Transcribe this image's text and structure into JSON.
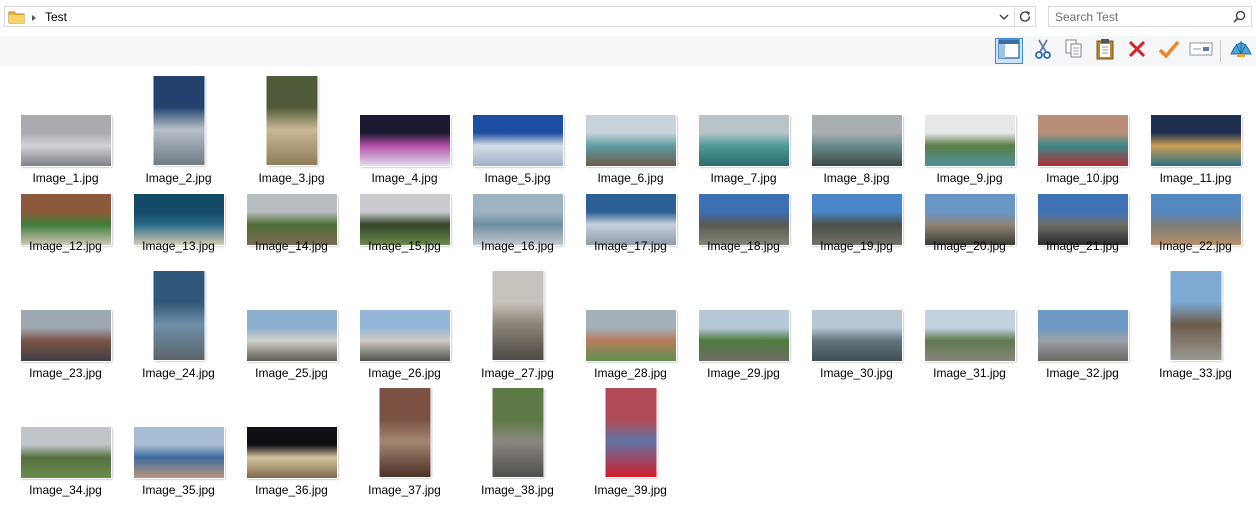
{
  "address_bar": {
    "path": "Test",
    "folder_icon": "folder-icon",
    "dropdown_icon": "chevron-down-icon",
    "refresh_icon": "refresh-icon"
  },
  "search": {
    "placeholder": "Search Test",
    "icon": "search-icon"
  },
  "toolbar": [
    {
      "name": "layout-pane-button",
      "icon": "layout-pane-icon",
      "active": true
    },
    {
      "name": "cut-button",
      "icon": "scissors-icon"
    },
    {
      "name": "copy-button",
      "icon": "copy-icon"
    },
    {
      "name": "paste-button",
      "icon": "clipboard-icon"
    },
    {
      "name": "delete-button",
      "icon": "red-x-icon"
    },
    {
      "name": "select-button",
      "icon": "orange-check-icon"
    },
    {
      "name": "rename-button",
      "icon": "rename-icon"
    },
    {
      "name": "shell-button",
      "icon": "shell-icon"
    }
  ],
  "files": [
    {
      "name": "Image_1.jpg",
      "orient": "landscape",
      "colors": [
        "#a9abaf",
        "#d2d3d6",
        "#7f8188"
      ]
    },
    {
      "name": "Image_2.jpg",
      "orient": "portrait",
      "colors": [
        "#23406f",
        "#b7c0c8",
        "#6f7a84"
      ]
    },
    {
      "name": "Image_3.jpg",
      "orient": "portrait",
      "colors": [
        "#4f5a3a",
        "#c9b994",
        "#8f7d5a"
      ]
    },
    {
      "name": "Image_4.jpg",
      "orient": "landscape",
      "colors": [
        "#1c1a33",
        "#b44fa7",
        "#e0e0f0"
      ]
    },
    {
      "name": "Image_5.jpg",
      "orient": "landscape",
      "colors": [
        "#1d4ea1",
        "#d6dde6",
        "#9fb1c9"
      ]
    },
    {
      "name": "Image_6.jpg",
      "orient": "landscape",
      "colors": [
        "#c8d3da",
        "#5f9ea2",
        "#6d5a4e"
      ]
    },
    {
      "name": "Image_7.jpg",
      "orient": "landscape",
      "colors": [
        "#b8c4c8",
        "#4c9a9a",
        "#2d6b6c"
      ]
    },
    {
      "name": "Image_8.jpg",
      "orient": "landscape",
      "colors": [
        "#a9aeb1",
        "#6b8b8c",
        "#3c4747"
      ]
    },
    {
      "name": "Image_9.jpg",
      "orient": "landscape",
      "colors": [
        "#e5e7e8",
        "#5a7d49",
        "#4f8f99"
      ]
    },
    {
      "name": "Image_10.jpg",
      "orient": "landscape",
      "colors": [
        "#b98e78",
        "#3a8787",
        "#b0303a"
      ]
    },
    {
      "name": "Image_11.jpg",
      "orient": "landscape",
      "colors": [
        "#1e2f4f",
        "#c99e55",
        "#2d6f86"
      ]
    },
    {
      "name": "Image_12.jpg",
      "orient": "landscape",
      "colors": [
        "#8c5a3a",
        "#3f7d3b",
        "#cfc7b8"
      ]
    },
    {
      "name": "Image_13.jpg",
      "orient": "landscape",
      "colors": [
        "#134a68",
        "#2a6a88",
        "#d8cdb4"
      ]
    },
    {
      "name": "Image_14.jpg",
      "orient": "landscape",
      "colors": [
        "#b9bcc0",
        "#4e6d33",
        "#7a6a52"
      ]
    },
    {
      "name": "Image_15.jpg",
      "orient": "landscape",
      "colors": [
        "#c9cbd0",
        "#334427",
        "#6c8a4d"
      ]
    },
    {
      "name": "Image_16.jpg",
      "orient": "landscape",
      "colors": [
        "#9fb4c2",
        "#6f8fa0",
        "#c2c8cc"
      ]
    },
    {
      "name": "Image_17.jpg",
      "orient": "landscape",
      "colors": [
        "#2c5f93",
        "#c9d1db",
        "#8d9aa9"
      ]
    },
    {
      "name": "Image_18.jpg",
      "orient": "landscape",
      "colors": [
        "#3d6fb3",
        "#585a52",
        "#848479"
      ]
    },
    {
      "name": "Image_19.jpg",
      "orient": "landscape",
      "colors": [
        "#4a84c9",
        "#4d5049",
        "#6f7068"
      ]
    },
    {
      "name": "Image_20.jpg",
      "orient": "landscape",
      "colors": [
        "#6a96c6",
        "#8d8576",
        "#3c3a35"
      ]
    },
    {
      "name": "Image_21.jpg",
      "orient": "landscape",
      "colors": [
        "#3e72b5",
        "#6e6e68",
        "#2a2b2c"
      ]
    },
    {
      "name": "Image_22.jpg",
      "orient": "landscape",
      "colors": [
        "#5589c2",
        "#7b7d7a",
        "#b78e69"
      ]
    },
    {
      "name": "Image_23.jpg",
      "orient": "landscape",
      "colors": [
        "#9fa7b0",
        "#7b5548",
        "#3e3f43"
      ]
    },
    {
      "name": "Image_24.jpg",
      "orient": "portrait",
      "colors": [
        "#2f5779",
        "#6f8fa7",
        "#5b6469"
      ]
    },
    {
      "name": "Image_25.jpg",
      "orient": "landscape",
      "colors": [
        "#8eb0cf",
        "#d3d1c8",
        "#5d5c56"
      ]
    },
    {
      "name": "Image_26.jpg",
      "orient": "landscape",
      "colors": [
        "#93b6d6",
        "#cfccc3",
        "#4f4f4c"
      ]
    },
    {
      "name": "Image_27.jpg",
      "orient": "portrait",
      "colors": [
        "#c6c3bc",
        "#8b8477",
        "#4c4a45"
      ]
    },
    {
      "name": "Image_28.jpg",
      "orient": "landscape",
      "colors": [
        "#a3b0b8",
        "#b67c5b",
        "#5f8f4f"
      ]
    },
    {
      "name": "Image_29.jpg",
      "orient": "landscape",
      "colors": [
        "#b7c9d8",
        "#4e7a3e",
        "#6e6d66"
      ]
    },
    {
      "name": "Image_30.jpg",
      "orient": "landscape",
      "colors": [
        "#b6c6d2",
        "#64747d",
        "#3f4e55"
      ]
    },
    {
      "name": "Image_31.jpg",
      "orient": "landscape",
      "colors": [
        "#c4d2de",
        "#5f7a4e",
        "#86857c"
      ]
    },
    {
      "name": "Image_32.jpg",
      "orient": "landscape",
      "colors": [
        "#6f98c4",
        "#9ba1a8",
        "#6a6862"
      ]
    },
    {
      "name": "Image_33.jpg",
      "orient": "portrait",
      "colors": [
        "#7ea9d3",
        "#6c5b4c",
        "#9a9992"
      ]
    },
    {
      "name": "Image_34.jpg",
      "orient": "landscape",
      "colors": [
        "#c1c5ca",
        "#557040",
        "#6b8c4d"
      ]
    },
    {
      "name": "Image_35.jpg",
      "orient": "landscape",
      "colors": [
        "#a6bdd3",
        "#3e6ba0",
        "#b9957b"
      ]
    },
    {
      "name": "Image_36.jpg",
      "orient": "landscape",
      "colors": [
        "#0f0f13",
        "#d6c4a2",
        "#7d6a4b"
      ]
    },
    {
      "name": "Image_37.jpg",
      "orient": "portrait",
      "colors": [
        "#7b5144",
        "#a38772",
        "#4b3026"
      ]
    },
    {
      "name": "Image_38.jpg",
      "orient": "portrait",
      "colors": [
        "#5d7a46",
        "#8b8780",
        "#4f4f4c"
      ]
    },
    {
      "name": "Image_39.jpg",
      "orient": "portrait",
      "colors": [
        "#b04a57",
        "#6273a5",
        "#d11d28"
      ]
    }
  ]
}
